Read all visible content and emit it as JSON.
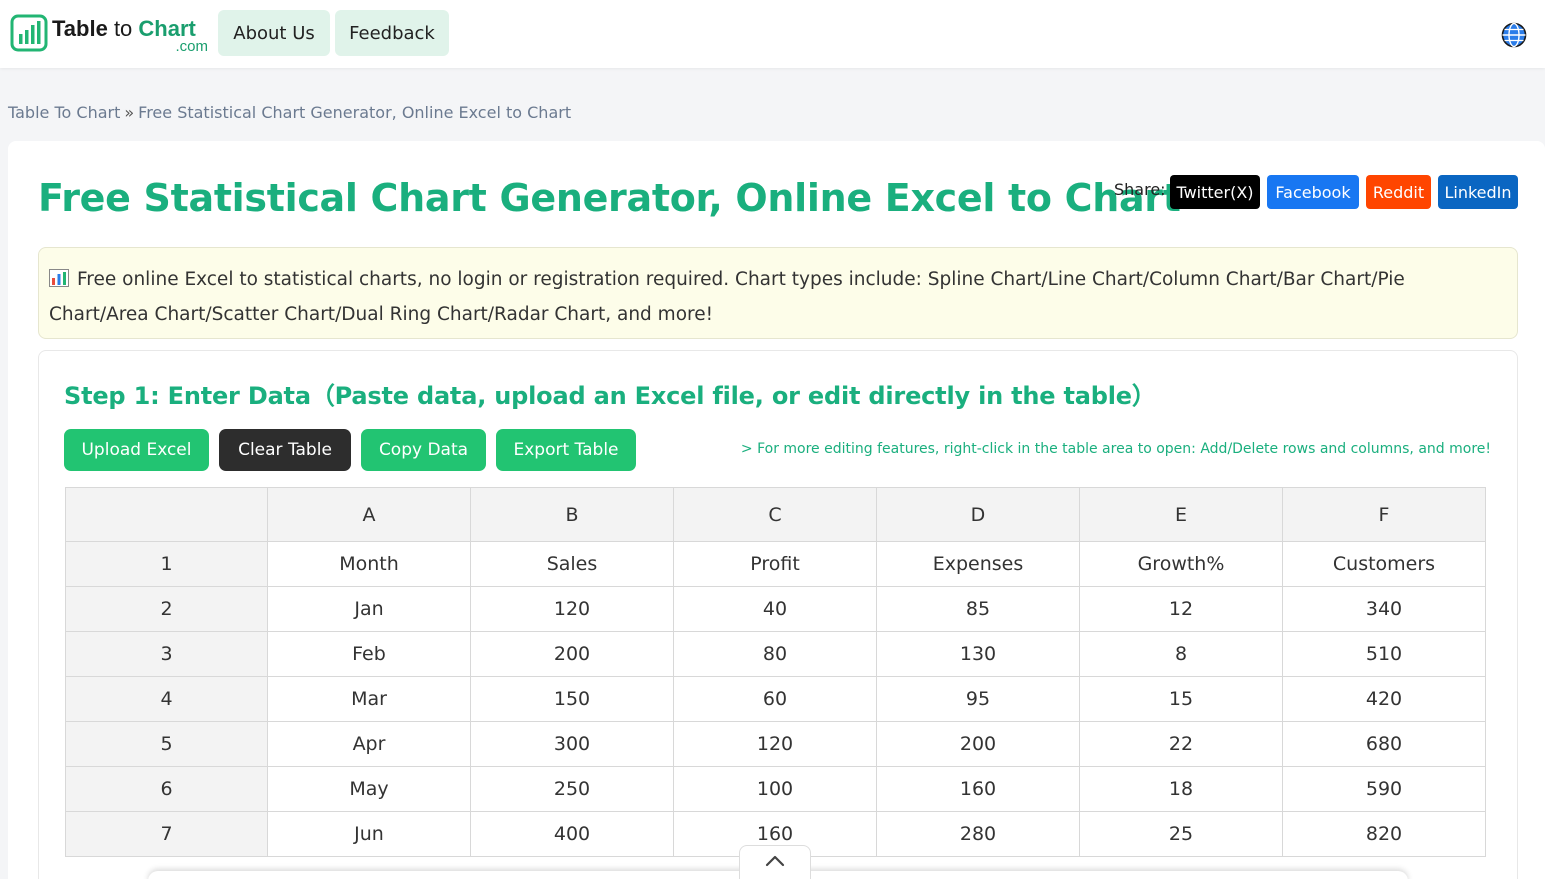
{
  "header": {
    "logo_name_a": "Table",
    "logo_name_b": " to ",
    "logo_name_c": "Chart",
    "logo_sub": ".com",
    "nav": [
      {
        "label": "About Us"
      },
      {
        "label": "Feedback"
      }
    ],
    "language_icon": "globe-icon"
  },
  "breadcrumb": {
    "home": "Table To Chart",
    "separator": "»",
    "current": "Free Statistical Chart Generator, Online Excel to Chart"
  },
  "page": {
    "title": "Free Statistical Chart Generator, Online Excel to Chart",
    "share_label": "Share:",
    "share_buttons": [
      {
        "label": "Twitter(X)",
        "color": "#000000"
      },
      {
        "label": "Facebook",
        "color": "#1877f2"
      },
      {
        "label": "Reddit",
        "color": "#ff4500"
      },
      {
        "label": "LinkedIn",
        "color": "#0a66c2"
      }
    ],
    "notice": "Free online Excel to statistical charts, no login or registration required. Chart types include: Spline Chart/Line Chart/Column Chart/Bar Chart/Pie Chart/Area Chart/Scatter Chart/Dual Ring Chart/Radar Chart, and more!"
  },
  "step1": {
    "title": "Step 1: Enter Data（Paste data, upload an Excel file, or edit directly in the table）",
    "buttons": {
      "upload": "Upload Excel",
      "clear": "Clear Table",
      "copy": "Copy Data",
      "export": "Export Table"
    },
    "hint": "> For more editing features, right-click in the table area to open: Add/Delete rows and columns, and more!",
    "table": {
      "columns": [
        "A",
        "B",
        "C",
        "D",
        "E",
        "F"
      ],
      "rows": [
        {
          "n": "1",
          "cells": [
            "Month",
            "Sales",
            "Profit",
            "Expenses",
            "Growth%",
            "Customers"
          ]
        },
        {
          "n": "2",
          "cells": [
            "Jan",
            "120",
            "40",
            "85",
            "12",
            "340"
          ]
        },
        {
          "n": "3",
          "cells": [
            "Feb",
            "200",
            "80",
            "130",
            "8",
            "510"
          ]
        },
        {
          "n": "4",
          "cells": [
            "Mar",
            "150",
            "60",
            "95",
            "15",
            "420"
          ]
        },
        {
          "n": "5",
          "cells": [
            "Apr",
            "300",
            "120",
            "200",
            "22",
            "680"
          ]
        },
        {
          "n": "6",
          "cells": [
            "May",
            "250",
            "100",
            "160",
            "18",
            "590"
          ]
        },
        {
          "n": "7",
          "cells": [
            "Jun",
            "400",
            "160",
            "280",
            "25",
            "820"
          ]
        }
      ]
    }
  },
  "colors": {
    "brand_green": "#1aaf7e",
    "button_green": "#22c472",
    "nav_bg": "#e0f3ea"
  }
}
